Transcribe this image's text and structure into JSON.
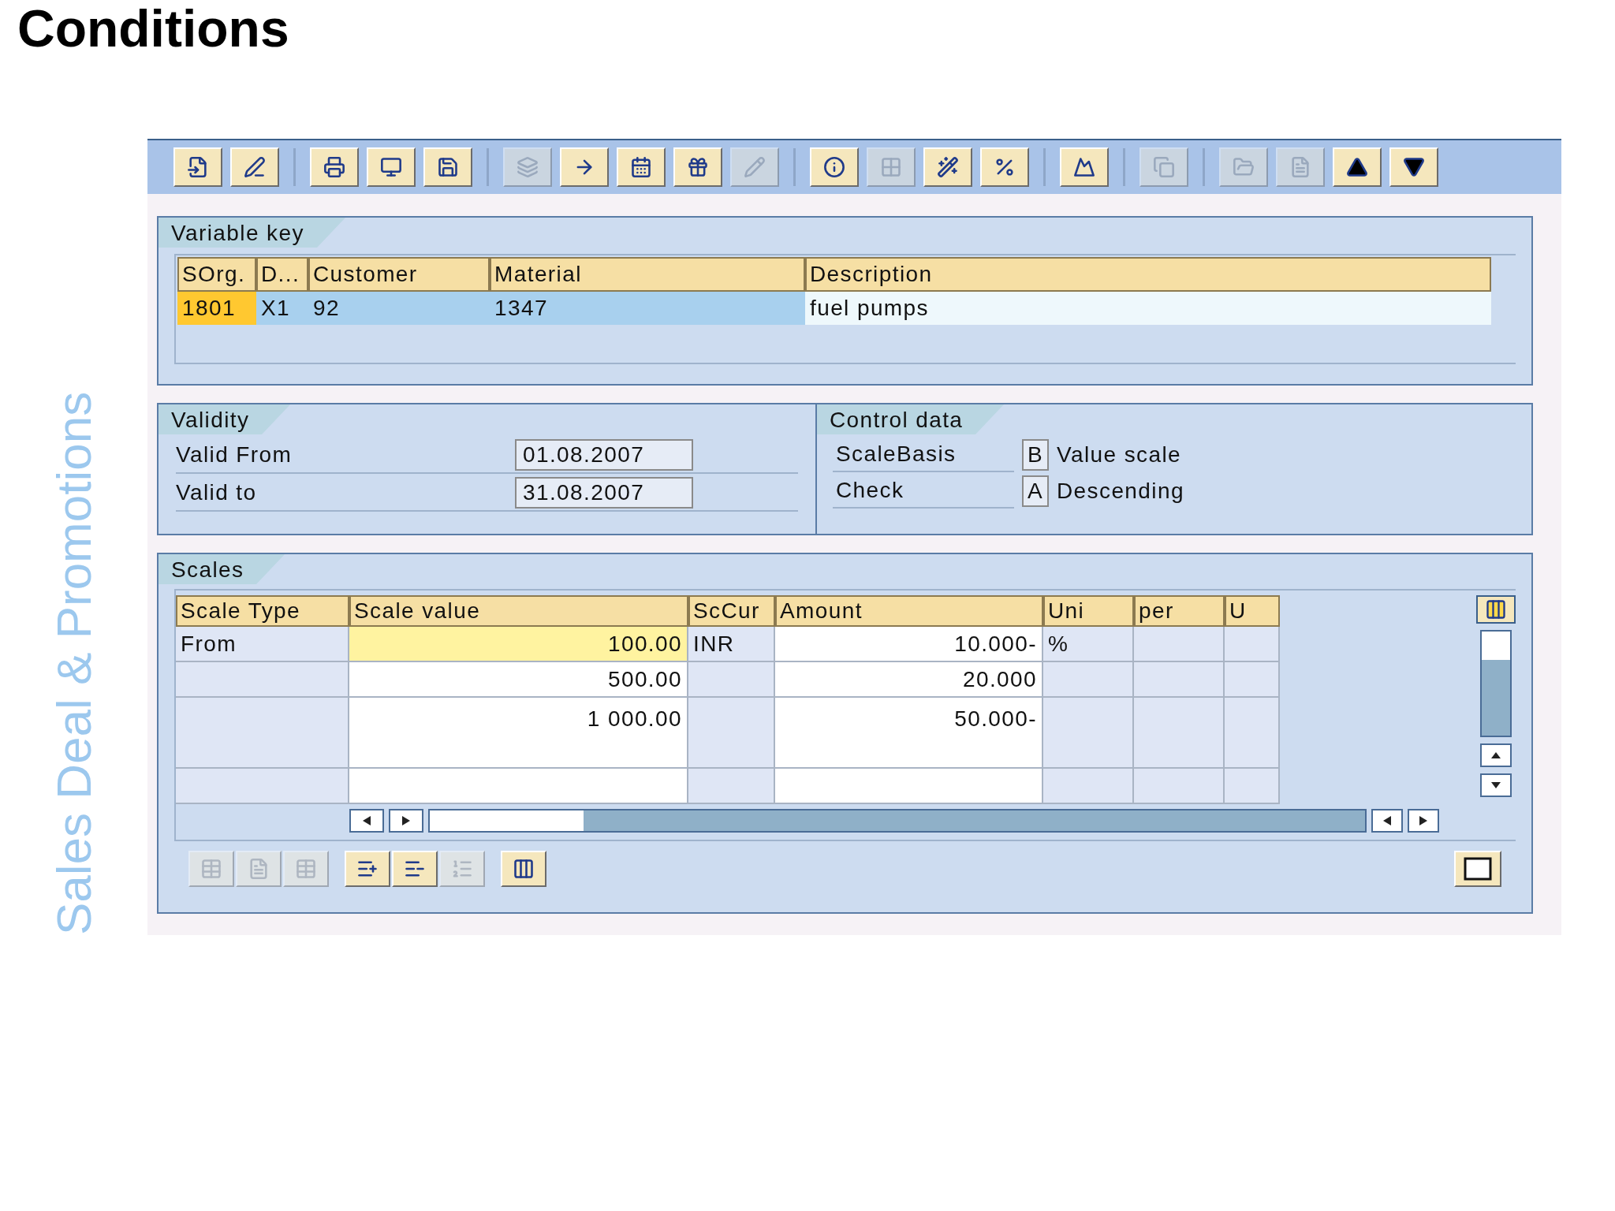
{
  "title": "Conditions",
  "side_caption": "Sales Deal & Promotions",
  "toolbar": [
    [
      {
        "disabled": false
      },
      {
        "disabled": false
      }
    ],
    [
      {
        "disabled": false
      },
      {
        "disabled": false
      },
      {
        "disabled": false
      }
    ],
    [
      {
        "disabled": true
      },
      {
        "disabled": false
      },
      {
        "disabled": false
      },
      {
        "disabled": false
      },
      {
        "disabled": true
      }
    ],
    [
      {
        "disabled": false
      },
      {
        "disabled": true
      },
      {
        "disabled": false
      },
      {
        "disabled": false
      }
    ],
    [
      {
        "disabled": false
      }
    ],
    [
      {
        "disabled": true
      }
    ],
    [
      {
        "disabled": true
      },
      {
        "disabled": true
      },
      {
        "disabled": false
      },
      {
        "disabled": false
      }
    ]
  ],
  "variable_key": {
    "title": "Variable key",
    "columns": [
      "SOrg.",
      "D...",
      "Customer",
      "Material",
      "Description"
    ],
    "rows": [
      {
        "cells": [
          "1801",
          "X1",
          "92",
          "1347",
          "fuel pumps"
        ]
      }
    ]
  },
  "validity": {
    "title": "Validity",
    "fields": [
      {
        "label": "Valid From",
        "value": "01.08.2007"
      },
      {
        "label": "Valid to",
        "value": "31.08.2007"
      }
    ]
  },
  "control_data": {
    "title": "Control data",
    "fields": [
      {
        "label": "ScaleBasis",
        "code": "B",
        "text": "Value scale"
      },
      {
        "label": "Check",
        "code": "A",
        "text": "Descending"
      }
    ]
  },
  "scales": {
    "title": "Scales",
    "columns": [
      "Scale Type",
      "Scale value",
      "ScCur",
      "Amount",
      "Uni",
      "per",
      "U"
    ],
    "rows": [
      {
        "selected": true,
        "scale_type": "From",
        "scale_value": "100.00",
        "currency": "INR",
        "amount": "10.000-",
        "unit": "%"
      },
      {
        "selected": false,
        "scale_value": "500.00",
        "amount": "20.000"
      },
      {
        "selected": false,
        "scale_value": "1 000.00",
        "amount": "50.000-"
      }
    ]
  },
  "bottom_toolbar": [
    [
      {
        "disabled": true
      },
      {
        "disabled": true
      },
      {
        "disabled": true
      }
    ],
    [
      {
        "disabled": false
      },
      {
        "disabled": false
      },
      {
        "disabled": true
      }
    ],
    [
      {
        "disabled": false
      }
    ]
  ]
}
